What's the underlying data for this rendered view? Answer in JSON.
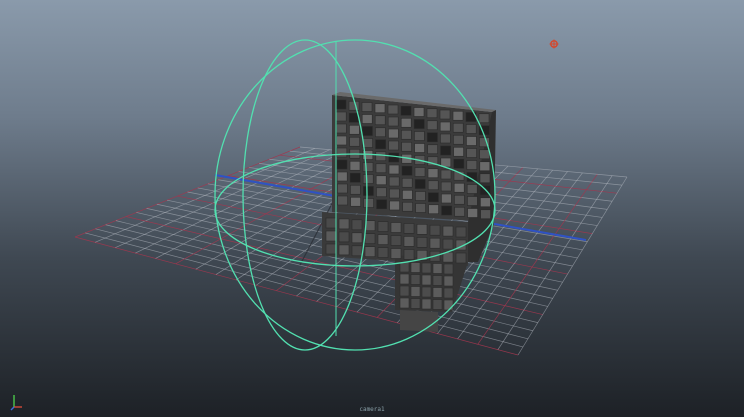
{
  "viewport": {
    "camera_label": "camera1",
    "background_top": "#8a9aab",
    "background_bottom": "#1d2126"
  },
  "colors": {
    "grid": "#b7bcc4",
    "grid_red": "#a2364e",
    "axis_blue": "#2f52c4",
    "manipulator": "#52e0b0",
    "mesh_dark": "#3b3b3b",
    "mesh_mid": "#555555",
    "mesh_light": "#6a6a6a",
    "light_icon": "#d6462a"
  },
  "icons": {
    "view_axis": "view-axis-icon",
    "light": "light-locator-icon"
  }
}
